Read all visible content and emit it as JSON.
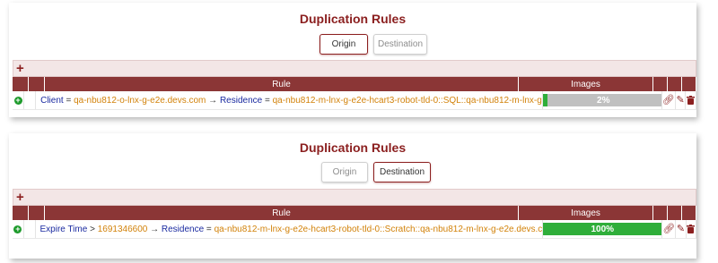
{
  "panels": [
    {
      "title": "Duplication Rules",
      "tabs": {
        "origin": "Origin",
        "destination": "Destination",
        "active": "origin"
      },
      "add_symbol": "+",
      "columns": {
        "rule": "Rule",
        "images": "Images"
      },
      "row": {
        "rule": [
          {
            "text": "Client",
            "kind": "k"
          },
          {
            "text": " = ",
            "kind": "p"
          },
          {
            "text": "qa-nbu812-o-lnx-g-e2e.devs.com",
            "kind": "v"
          },
          {
            "text": " → ",
            "kind": "p"
          },
          {
            "text": "Residence",
            "kind": "k"
          },
          {
            "text": " = ",
            "kind": "p"
          },
          {
            "text": "qa-nbu812-m-lnx-g-e2e-hcart3-robot-tld-0::SQL::qa-nbu812-m-lnx-g",
            "kind": "v"
          }
        ],
        "images_label": "2%",
        "images_progress": 0.02
      }
    },
    {
      "title": "Duplication Rules",
      "tabs": {
        "origin": "Origin",
        "destination": "Destination",
        "active": "destination"
      },
      "add_symbol": "+",
      "columns": {
        "rule": "Rule",
        "images": "Images"
      },
      "row": {
        "rule": [
          {
            "text": "Expire Time",
            "kind": "k"
          },
          {
            "text": " > ",
            "kind": "p"
          },
          {
            "text": "1691346600",
            "kind": "v"
          },
          {
            "text": " → ",
            "kind": "p"
          },
          {
            "text": "Residence",
            "kind": "k"
          },
          {
            "text": " = ",
            "kind": "p"
          },
          {
            "text": "qa-nbu812-m-lnx-g-e2e-hcart3-robot-tld-0::Scratch::qa-nbu812-m-lnx-g-e2e.devs.c",
            "kind": "v"
          }
        ],
        "images_label": "100%",
        "images_progress": 1.0
      }
    }
  ],
  "icons": {
    "expand": "plus-circle-icon",
    "link": "link-icon",
    "edit": "pencil-icon",
    "delete": "trash-icon"
  },
  "colors": {
    "accent": "#8b1f1f",
    "header": "#8b3636",
    "key_text": "#1a2aa0",
    "value_text": "#d2820a",
    "progress": "#2fae3a"
  }
}
